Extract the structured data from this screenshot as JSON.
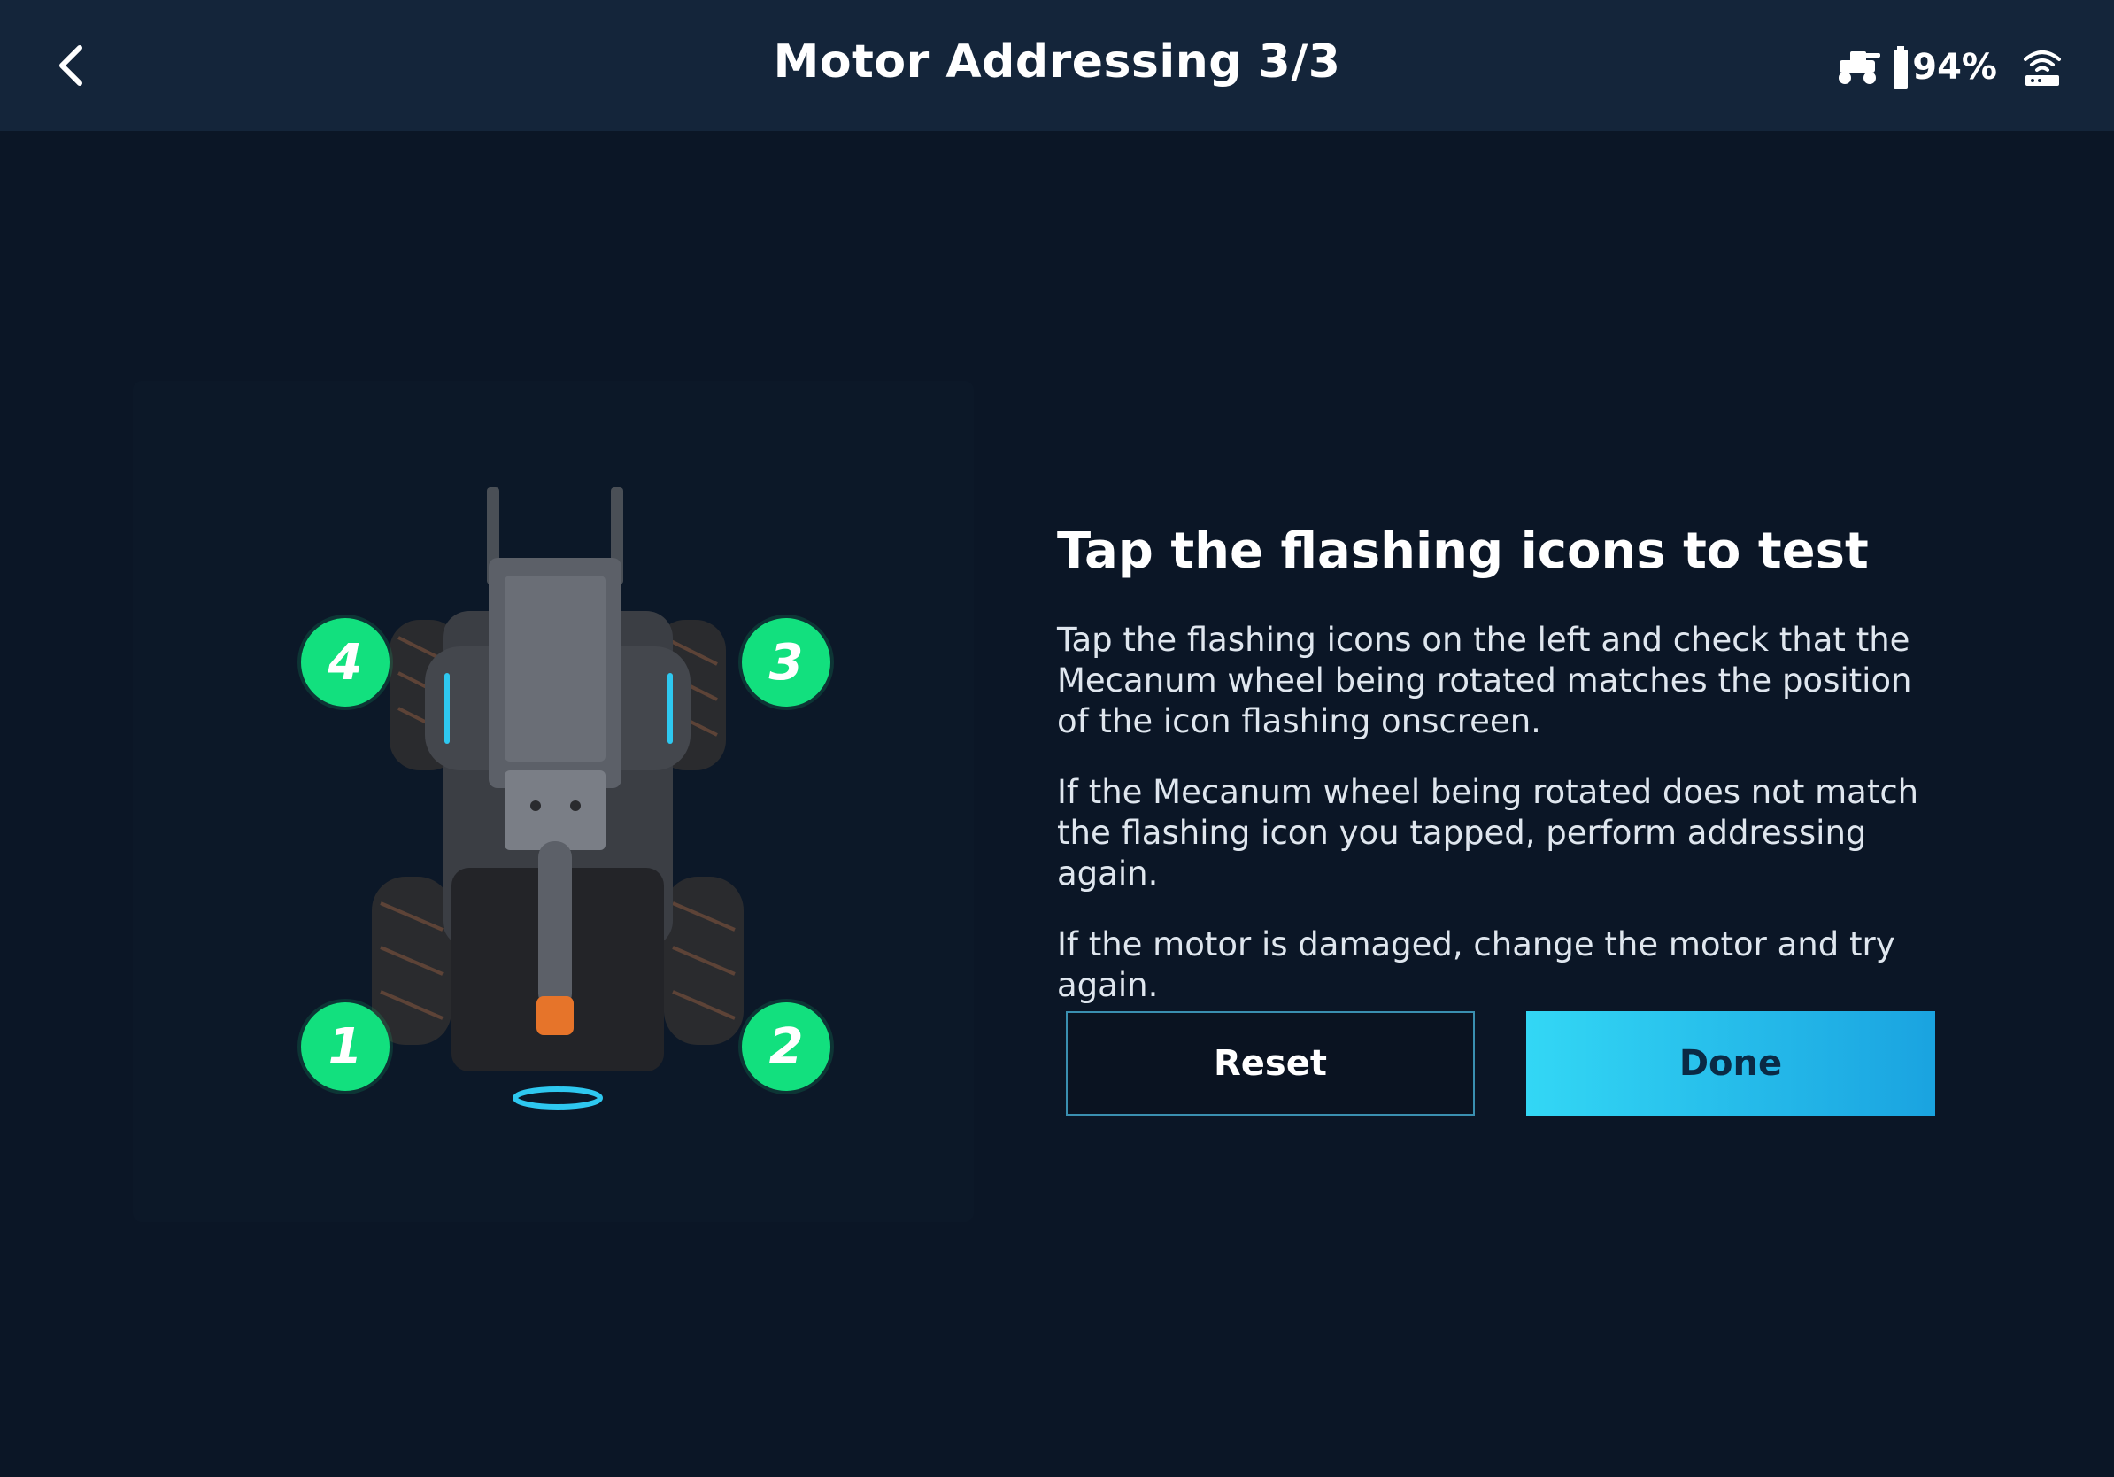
{
  "header": {
    "title": "Motor Addressing 3/3",
    "battery_percent": "94%"
  },
  "illustration": {
    "badges": {
      "front_left": "4",
      "front_right": "3",
      "rear_left": "1",
      "rear_right": "2"
    },
    "badge_color": "#12e07e"
  },
  "content": {
    "heading": "Tap the flashing icons to test",
    "paragraphs": [
      "Tap the flashing icons on the left and check that the Mecanum wheel being rotated matches the position of the icon flashing onscreen.",
      "If the Mecanum wheel being rotated does not match the flashing icon you tapped, perform addressing again.",
      "If the motor is damaged, change the motor and try again."
    ]
  },
  "buttons": {
    "reset_label": "Reset",
    "done_label": "Done"
  },
  "colors": {
    "header_bg": "#14253a",
    "page_bg": "#0b1626",
    "accent": "#33d7f5"
  }
}
